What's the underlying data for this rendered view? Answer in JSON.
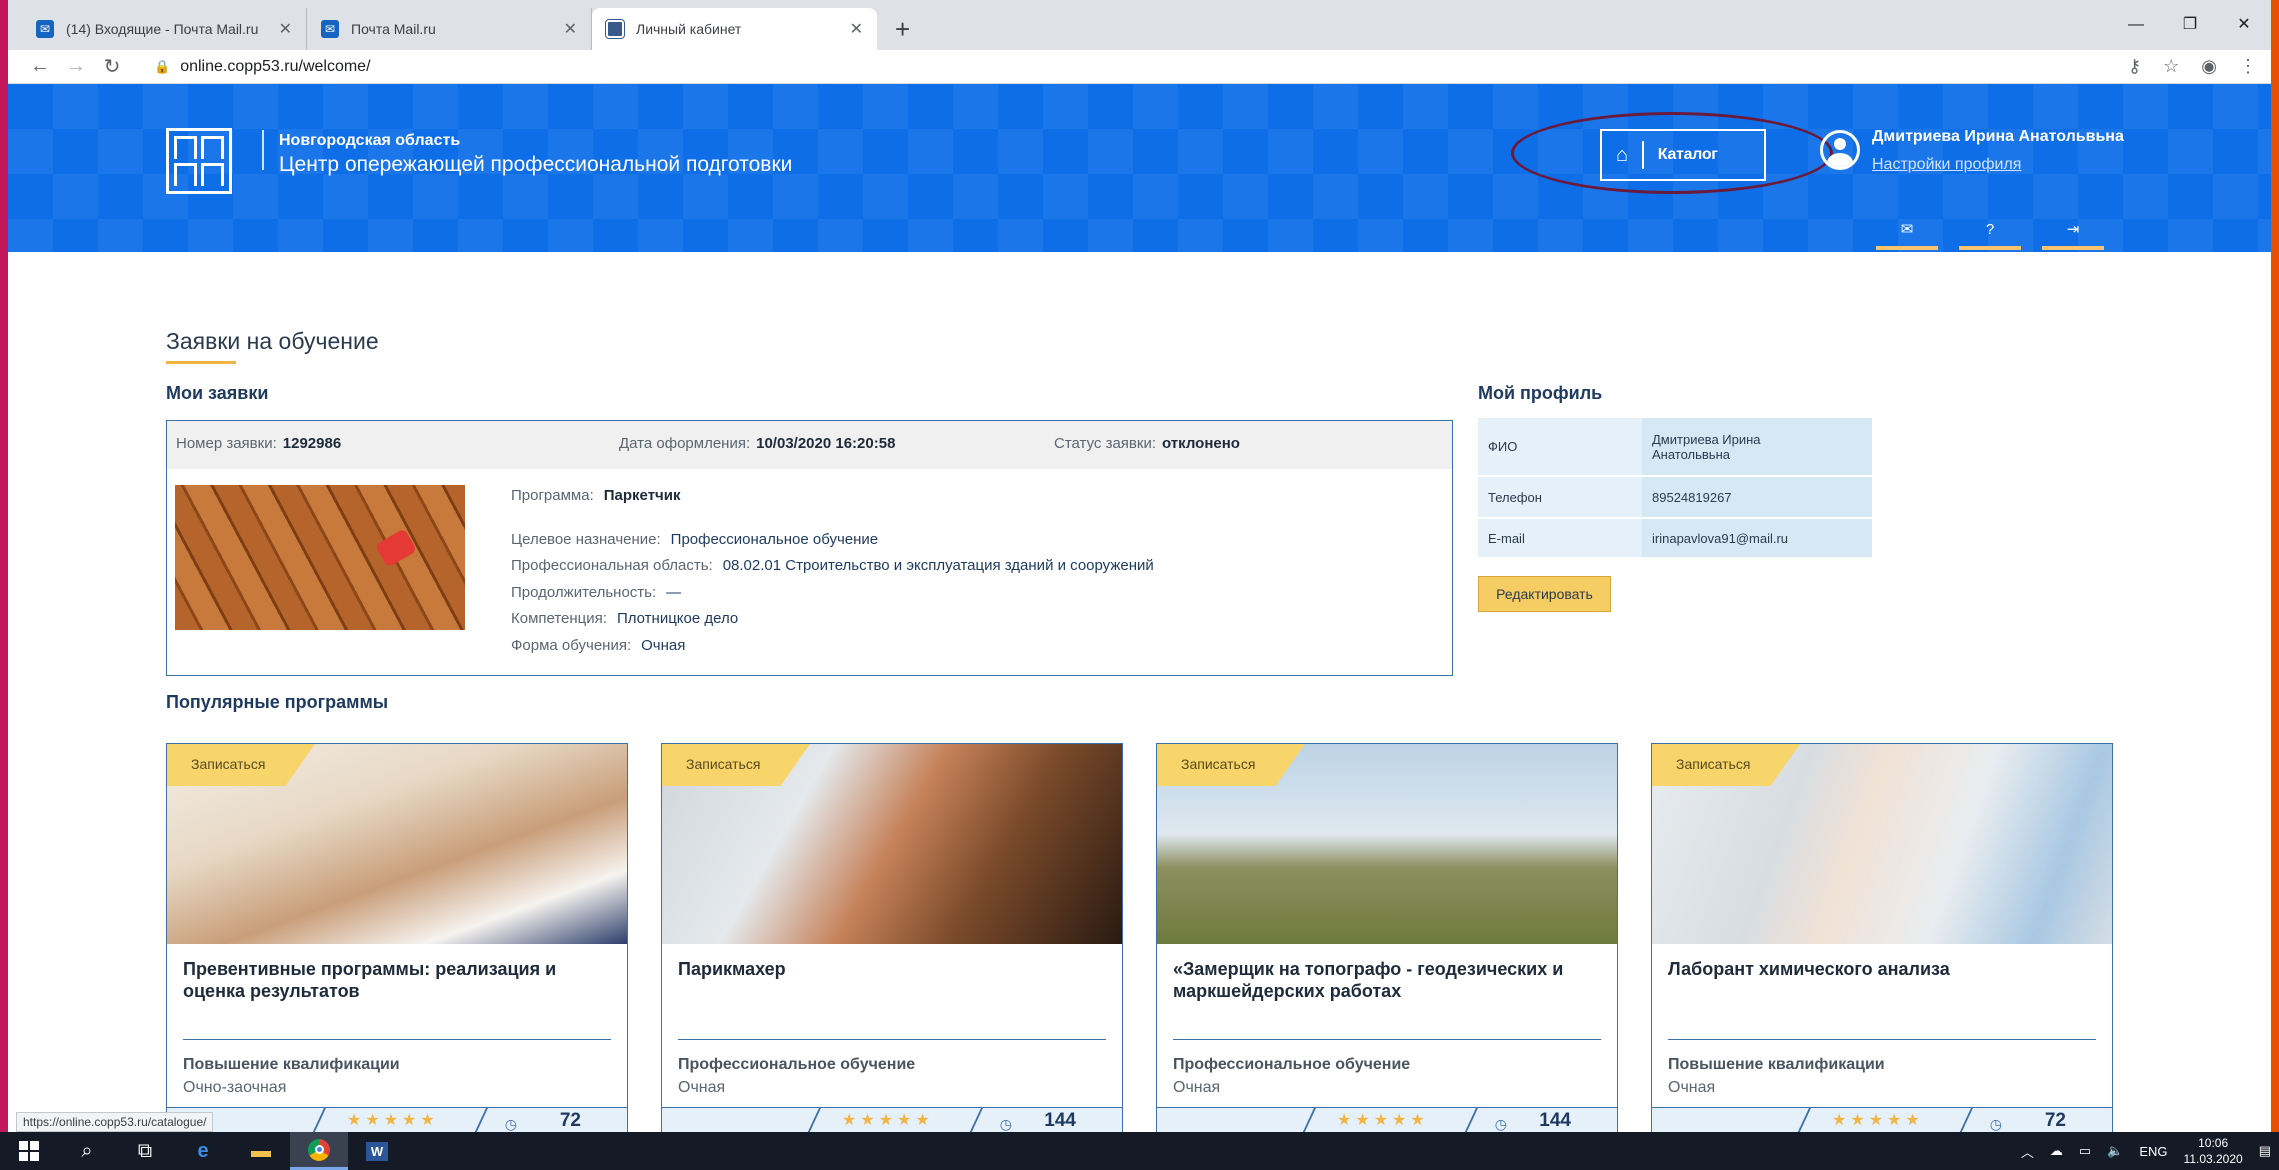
{
  "browser": {
    "tabs": [
      {
        "label": "(14) Входящие - Почта Mail.ru",
        "favicon": "mail-icon",
        "active": false
      },
      {
        "label": "Почта Mail.ru",
        "favicon": "mail-icon",
        "active": false
      },
      {
        "label": "Личный кабинет",
        "favicon": "copp-icon",
        "active": true
      }
    ],
    "new_tab": "+",
    "url": "online.copp53.ru/welcome/",
    "status_url": "https://online.copp53.ru/catalogue/"
  },
  "header": {
    "region": "Новгородская область",
    "title": "Центр опережающей профессиональной подготовки",
    "catalog_label": "Каталог",
    "user_name": "Дмитриева Ирина Анатольвьна",
    "profile_link": "Настройки профиля",
    "icons": [
      "mail-icon",
      "help-icon",
      "logout-icon"
    ]
  },
  "page": {
    "title": "Заявки на обучение",
    "my_requests_heading": "Мои заявки",
    "profile_heading": "Мой профиль",
    "popular_heading": "Популярные программы"
  },
  "request": {
    "number_label": "Номер заявки:",
    "number": "1292986",
    "date_label": "Дата оформления:",
    "date": "10/03/2020 16:20:58",
    "status_label": "Статус заявки:",
    "status": "отклонено",
    "program_label": "Программа:",
    "program": "Паркетчик",
    "purpose_label": "Целевое назначение:",
    "purpose": "Профессиональное обучение",
    "area_label": "Профессиональная область:",
    "area": "08.02.01 Строительство и эксплуатация зданий и сооружений",
    "duration_label": "Продолжительность:",
    "duration": "—",
    "competence_label": "Компетенция:",
    "competence": "Плотницкое дело",
    "form_label": "Форма обучения:",
    "form": "Очная"
  },
  "profile": {
    "rows": [
      {
        "key": "ФИО",
        "value": "Дмитриева Ирина Анатольвьна"
      },
      {
        "key": "Телефон",
        "value": "89524819267"
      },
      {
        "key": "E-mail",
        "value": "irinapavlova91@mail.ru"
      }
    ],
    "edit_label": "Редактировать"
  },
  "programs": [
    {
      "enroll": "Записаться",
      "title": "Превентивные программы: реализация и оценка результатов",
      "type": "Повышение квалификации",
      "form": "Очно-заочная",
      "count": "72",
      "rating": "★★★★★"
    },
    {
      "enroll": "Записаться",
      "title": "Парикмахер",
      "type": "Профессиональное обучение",
      "form": "Очная",
      "count": "144",
      "rating": "★★★★★"
    },
    {
      "enroll": "Записаться",
      "title": "«Замерщик на топографо - геодезических и маркшейдерских работах",
      "type": "Профессиональное обучение",
      "form": "Очная",
      "count": "144",
      "rating": "★★★★★"
    },
    {
      "enroll": "Записаться",
      "title": "Лаборант химического анализа",
      "type": "Повышение квалификации",
      "form": "Очная",
      "count": "72",
      "rating": "★★★★★"
    }
  ],
  "taskbar": {
    "lang": "ENG",
    "time": "10:06",
    "date": "11.03.2020"
  },
  "colors": {
    "header_blue": "#0d6ee8",
    "accent_yellow": "#f5cd62",
    "border_blue": "#3d6fa8"
  }
}
